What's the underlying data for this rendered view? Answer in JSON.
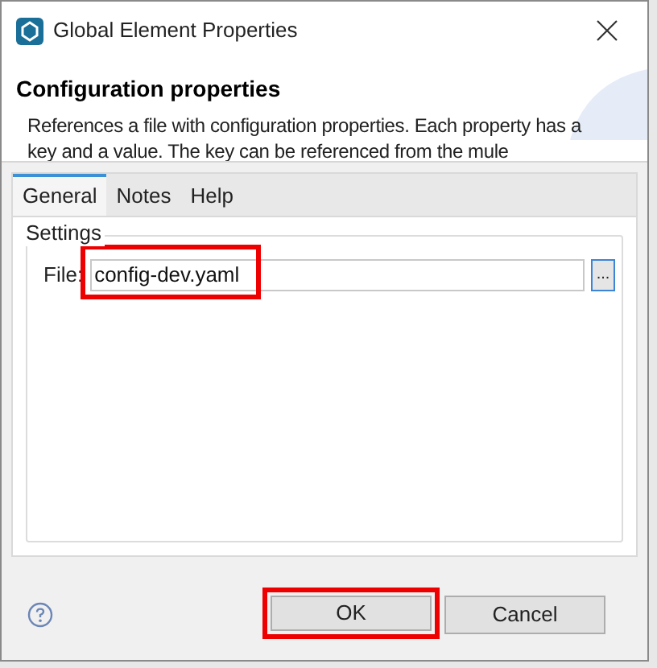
{
  "window": {
    "title": "Global Element Properties"
  },
  "header": {
    "title": "Configuration properties",
    "description": "References a file with configuration properties. Each property has a key and a value. The key can be referenced from the mule"
  },
  "tabs": [
    {
      "label": "General",
      "selected": true
    },
    {
      "label": "Notes",
      "selected": false
    },
    {
      "label": "Help",
      "selected": false
    }
  ],
  "settings": {
    "group_title": "Settings",
    "file_label": "File:",
    "file_value": "config-dev.yaml",
    "file_highlighted": true,
    "browse_label": "..."
  },
  "buttons": [
    {
      "label": "OK",
      "highlighted": true
    },
    {
      "label": "Cancel",
      "highlighted": false
    }
  ]
}
